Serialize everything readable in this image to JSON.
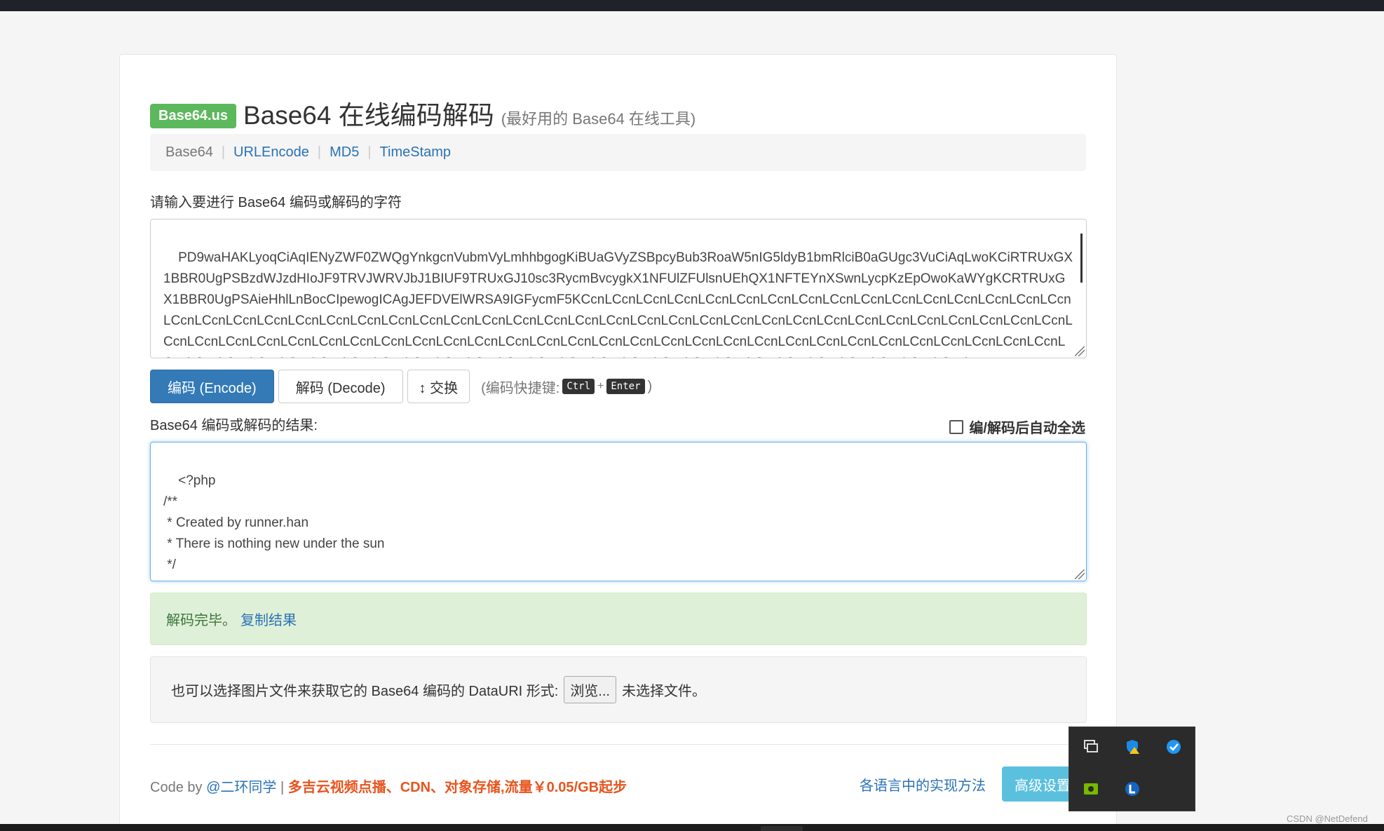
{
  "brand": {
    "badge": "Base64.us",
    "title": "Base64 在线编码解码",
    "subtitle": "(最好用的 Base64 在线工具)"
  },
  "nav": {
    "items": [
      "Base64",
      "URLEncode",
      "MD5",
      "TimeStamp"
    ]
  },
  "input": {
    "label": "请输入要进行 Base64 编码或解码的字符",
    "value": "PD9waHAKLyoqCiAqIENyZWF0ZWQgYnkgcnVubmVyLmhhbgogKiBUaGVyZSBpcyBub3RoaW5nIG5ldyB1bmRlciB0aGUgc3VuCiAqLwoKCiRTRUxGX1BBR0UgPSBzdWJzdHIoJF9TRVJWRVJbJ1BIUF9TRUxGJ10sc3RycmBvcygkX1NFUlZFUlsnUEhQX1NFTEYnXSwnLycpKzEpOwoKaWYgKCRTRUxGX1BBR0UgPSAieHhlLnBocCIpewogICAgJEFDVElWRSA9IGFycmF5KCcnLCcnLCcnLCcnLCcnLCcnLCcnLCcnLCcnLCcnLCcnLCcnLCcnLCcnLCcnLCcnLCcnLCcnLCcnLCcnLCcnLCcnLCcnLCcnLCcnLCcnLCcnLCcnLCcnLCcnLCcnLCcnLCcnLCcnLCcnLCcnLCcnLCcnLCcnLCcnLCcnLCcnLCcnLCcnLCcnLCcnLCcnLCcnLCcnLCcnLCcnLCcnLCcnLCcnLCcnLCcnLCcnLCcnLCcnLCcnLCcnLCcnLCcnLCcnLCcnLCcnLCcnLCcnLCcnLCcnLCcnLCcnLCcnLCcnLCcnLCcnLCcnLCcnLCcnLCcnLCcnLCcnLCcnLCcnLCcnLCcnLCcnLCcnLCcnLCcnLCcnLCcnLCcnLCcnLCcnLCcnLCcnLCcnLCcnLCcnL"
  },
  "actions": {
    "encode": "编码 (Encode)",
    "decode": "解码 (Decode)",
    "swap": "↕ 交换",
    "hint_prefix": "(编码快捷键:",
    "key1": "Ctrl",
    "plus": "+",
    "key2": "Enter",
    "hint_suffix": ")"
  },
  "output": {
    "label": "Base64 编码或解码的结果:",
    "auto_select": "编/解码后自动全选",
    "value": "<?php\n/**\n * Created by runner.han\n * There is nothing new under the sun\n */"
  },
  "status": {
    "message": "解码完毕。",
    "copy_link": "复制结果"
  },
  "datauri": {
    "text": "也可以选择图片文件来获取它的 Base64 编码的 DataURI 形式:",
    "browse": "浏览...",
    "no_file": "未选择文件。"
  },
  "footer": {
    "code_by": "Code by",
    "author": "@二环同学",
    "separator": "|",
    "promo": "多吉云视频点播、CDN、对象存储,流量￥0.05/GB起步",
    "impl_link": "各语言中的实现方法",
    "advanced": "高级设置"
  },
  "watermark": "CSDN @NetDefend",
  "colors": {
    "badge": "#5cb85c",
    "primary": "#337ab7",
    "link": "#2a72b5",
    "success_bg": "#dff0d8",
    "promo": "#e8541e",
    "advanced": "#5bc0de"
  },
  "tray_icons": [
    "display-icon",
    "defender-warning-icon",
    "browser-icon",
    "nvidia-icon",
    "app-l-icon"
  ]
}
